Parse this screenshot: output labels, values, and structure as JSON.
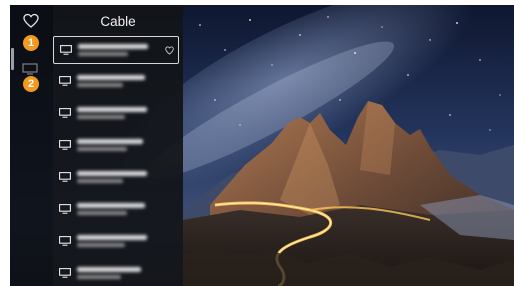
{
  "panel": {
    "title": "Cable"
  },
  "rail": {
    "items": [
      {
        "icon": "heart-icon"
      },
      {
        "icon": "tv-icon"
      }
    ]
  },
  "callouts": [
    "1",
    "2"
  ],
  "channels": [
    {
      "icon": "tv-icon",
      "selected": true,
      "favorite": true
    },
    {
      "icon": "tv-icon"
    },
    {
      "icon": "tv-icon"
    },
    {
      "icon": "tv-icon"
    },
    {
      "icon": "tv-icon"
    },
    {
      "icon": "tv-icon"
    },
    {
      "icon": "tv-icon"
    },
    {
      "icon": "tv-icon"
    }
  ],
  "colors": {
    "callout": "#f39a1e",
    "panel_bg": "#141619",
    "text": "#f2f2f2"
  }
}
